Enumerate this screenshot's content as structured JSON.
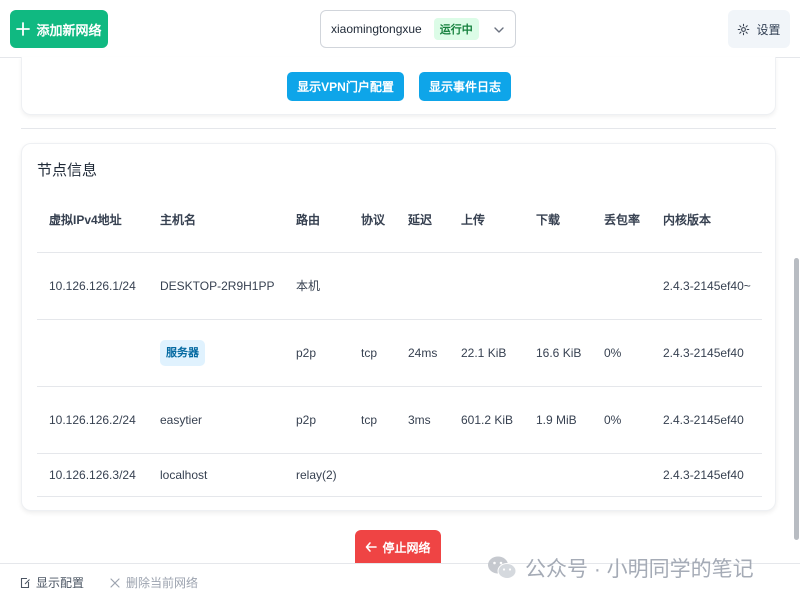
{
  "header": {
    "add_network_label": "添加新网络",
    "network_name": "xiaomingtongxue",
    "status": "运行中",
    "settings_label": "设置"
  },
  "actions": {
    "show_vpn_portal_label": "显示VPN门户配置",
    "show_event_log_label": "显示事件日志"
  },
  "node_info": {
    "title": "节点信息",
    "columns": [
      "虚拟IPv4地址",
      "主机名",
      "路由",
      "协议",
      "延迟",
      "上传",
      "下载",
      "丢包率",
      "内核版本"
    ],
    "rows": [
      {
        "ip": "10.126.126.1/24",
        "hostname": "DESKTOP-2R9H1PP",
        "route": "本机",
        "protocol": "",
        "latency": "",
        "upload": "",
        "download": "",
        "loss": "",
        "version": "2.4.3-2145ef40~"
      },
      {
        "ip": "",
        "hostname": "服务器",
        "route": "p2p",
        "protocol": "tcp",
        "latency": "24ms",
        "upload": "22.1 KiB",
        "download": "16.6 KiB",
        "loss": "0%",
        "version": "2.4.3-2145ef40"
      },
      {
        "ip": "10.126.126.2/24",
        "hostname": "easytier",
        "route": "p2p",
        "protocol": "tcp",
        "latency": "3ms",
        "upload": "601.2 KiB",
        "download": "1.9 MiB",
        "loss": "0%",
        "version": "2.4.3-2145ef40"
      },
      {
        "ip": "10.126.126.3/24",
        "hostname": "localhost",
        "route": "relay(2)",
        "protocol": "",
        "latency": "",
        "upload": "",
        "download": "",
        "loss": "",
        "version": "2.4.3-2145ef40"
      }
    ]
  },
  "stop_label": "停止网络",
  "footer": {
    "show_config_label": "显示配置",
    "delete_network_label": "删除当前网络"
  },
  "watermark": "公众号 · 小明同学的笔记",
  "colors": {
    "primary_green": "#10b981",
    "action_blue": "#0ea5e9",
    "danger_red": "#ef4444",
    "status_green": "#15803d"
  }
}
